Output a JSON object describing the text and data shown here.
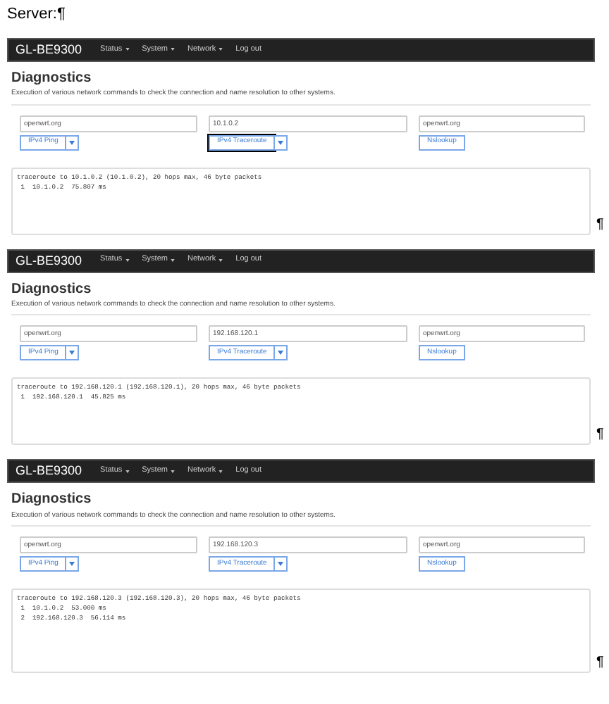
{
  "header": {
    "text": "Server:",
    "mark": "¶"
  },
  "panels": [
    {
      "brand": "GL-BE9300",
      "menu": [
        {
          "label": "Status",
          "dropdown": true
        },
        {
          "label": "System",
          "dropdown": true
        },
        {
          "label": "Network",
          "dropdown": true
        },
        {
          "label": "Log out",
          "dropdown": false
        }
      ],
      "title": "Diagnostics",
      "description": "Execution of various network commands to check the connection and name resolution to other systems.",
      "tools": [
        {
          "value": "openwrt.org",
          "button": "IPv4 Ping",
          "split": true,
          "focused": false
        },
        {
          "value": "10.1.0.2",
          "button": "IPv4 Traceroute",
          "split": true,
          "focused": true
        },
        {
          "value": "openwrt.org",
          "button": "Nslookup",
          "split": false,
          "focused": false
        }
      ],
      "output": [
        "traceroute to 10.1.0.2 (10.1.0.2), 20 hops max, 46 byte packets",
        " 1  10.1.0.2  75.807 ms"
      ],
      "mark": "¶"
    },
    {
      "brand": "GL-BE9300",
      "menu": [
        {
          "label": "Status",
          "dropdown": true
        },
        {
          "label": "System",
          "dropdown": true
        },
        {
          "label": "Network",
          "dropdown": true
        },
        {
          "label": "Log out",
          "dropdown": false
        }
      ],
      "title": "Diagnostics",
      "description": "Execution of various network commands to check the connection and name resolution to other systems.",
      "tools": [
        {
          "value": "openwrt.org",
          "button": "IPv4 Ping",
          "split": true,
          "focused": false
        },
        {
          "value": "192.168.120.1",
          "button": "IPv4 Traceroute",
          "split": true,
          "focused": false
        },
        {
          "value": "openwrt.org",
          "button": "Nslookup",
          "split": false,
          "focused": false
        }
      ],
      "output": [
        "traceroute to 192.168.120.1 (192.168.120.1), 20 hops max, 46 byte packets",
        " 1  192.168.120.1  45.825 ms"
      ],
      "mark": "¶"
    },
    {
      "brand": "GL-BE9300",
      "menu": [
        {
          "label": "Status",
          "dropdown": true
        },
        {
          "label": "System",
          "dropdown": true
        },
        {
          "label": "Network",
          "dropdown": true
        },
        {
          "label": "Log out",
          "dropdown": false
        }
      ],
      "title": "Diagnostics",
      "description": "Execution of various network commands to check the connection and name resolution to other systems.",
      "tools": [
        {
          "value": "openwrt.org",
          "button": "IPv4 Ping",
          "split": true,
          "focused": false
        },
        {
          "value": "192.168.120.3",
          "button": "IPv4 Traceroute",
          "split": true,
          "focused": false
        },
        {
          "value": "openwrt.org",
          "button": "Nslookup",
          "split": false,
          "focused": false
        }
      ],
      "output": [
        "traceroute to 192.168.120.3 (192.168.120.3), 20 hops max, 46 byte packets",
        " 1  10.1.0.2  53.000 ms",
        " 2  192.168.120.3  56.114 ms"
      ],
      "mark": "¶"
    }
  ]
}
